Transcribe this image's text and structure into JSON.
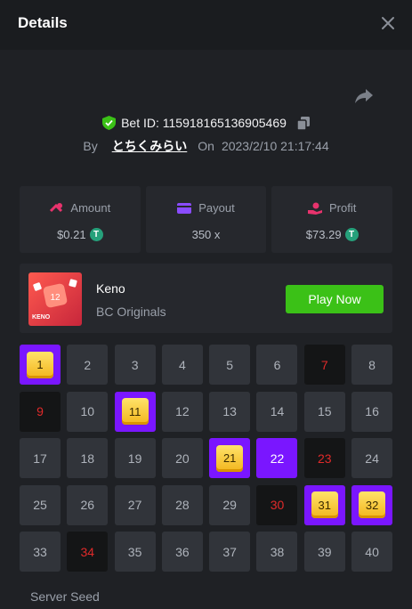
{
  "header": {
    "title": "Details"
  },
  "bet": {
    "id_label": "Bet ID: 115918165136905469",
    "by_label": "By",
    "user": "とちくみらい",
    "on_label": "On",
    "datetime": "2023/2/10 21:17:44"
  },
  "stats": {
    "amount": {
      "label": "Amount",
      "value": "$0.21"
    },
    "payout": {
      "label": "Payout",
      "value": "350 x"
    },
    "profit": {
      "label": "Profit",
      "value": "$73.29"
    }
  },
  "game": {
    "name": "Keno",
    "provider": "BC Originals",
    "thumb_label": "KENO",
    "thumb_number": "12",
    "play_label": "Play Now"
  },
  "grid": {
    "cells": [
      {
        "n": "1",
        "state": "hit"
      },
      {
        "n": "2",
        "state": "normal"
      },
      {
        "n": "3",
        "state": "normal"
      },
      {
        "n": "4",
        "state": "normal"
      },
      {
        "n": "5",
        "state": "normal"
      },
      {
        "n": "6",
        "state": "normal"
      },
      {
        "n": "7",
        "state": "miss"
      },
      {
        "n": "8",
        "state": "normal"
      },
      {
        "n": "9",
        "state": "miss"
      },
      {
        "n": "10",
        "state": "normal"
      },
      {
        "n": "11",
        "state": "hit"
      },
      {
        "n": "12",
        "state": "normal"
      },
      {
        "n": "13",
        "state": "normal"
      },
      {
        "n": "14",
        "state": "normal"
      },
      {
        "n": "15",
        "state": "normal"
      },
      {
        "n": "16",
        "state": "normal"
      },
      {
        "n": "17",
        "state": "normal"
      },
      {
        "n": "18",
        "state": "normal"
      },
      {
        "n": "19",
        "state": "normal"
      },
      {
        "n": "20",
        "state": "normal"
      },
      {
        "n": "21",
        "state": "hit"
      },
      {
        "n": "22",
        "state": "selected"
      },
      {
        "n": "23",
        "state": "miss"
      },
      {
        "n": "24",
        "state": "normal"
      },
      {
        "n": "25",
        "state": "normal"
      },
      {
        "n": "26",
        "state": "normal"
      },
      {
        "n": "27",
        "state": "normal"
      },
      {
        "n": "28",
        "state": "normal"
      },
      {
        "n": "29",
        "state": "normal"
      },
      {
        "n": "30",
        "state": "miss"
      },
      {
        "n": "31",
        "state": "hit"
      },
      {
        "n": "32",
        "state": "hit"
      },
      {
        "n": "33",
        "state": "normal"
      },
      {
        "n": "34",
        "state": "miss"
      },
      {
        "n": "35",
        "state": "normal"
      },
      {
        "n": "36",
        "state": "normal"
      },
      {
        "n": "37",
        "state": "normal"
      },
      {
        "n": "38",
        "state": "normal"
      },
      {
        "n": "39",
        "state": "normal"
      },
      {
        "n": "40",
        "state": "normal"
      }
    ]
  },
  "footer": {
    "server_seed_label": "Server Seed"
  },
  "icons": {
    "close": "close-icon",
    "share": "share-icon",
    "verified": "shield-check-icon",
    "copy": "copy-icon",
    "amount": "bet-chips-icon",
    "payout": "wallet-icon",
    "profit": "hand-coin-icon",
    "currency": "usdt-coin-icon"
  },
  "colors": {
    "background": "#1f2125",
    "card": "#26282d",
    "cell": "#31343a",
    "accent_purple": "#7a16ff",
    "accent_green": "#3bc117",
    "miss_red": "#e02a2a",
    "gem_yellow": "#f2b51c"
  }
}
